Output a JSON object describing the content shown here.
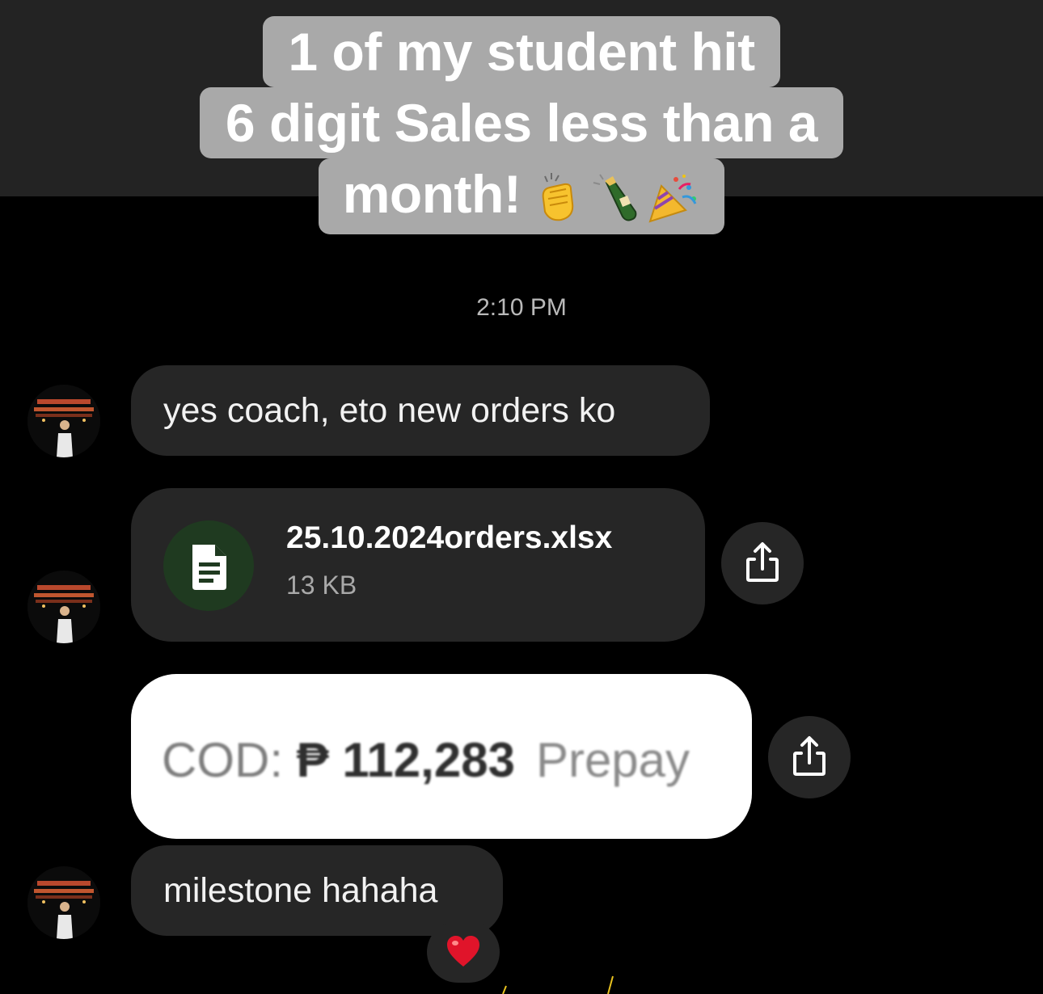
{
  "caption": {
    "line1": "1 of my student hit",
    "line2": "6 digit Sales less than a",
    "line3": "month!",
    "emojis": [
      "clapping-hands-icon",
      "champagne-bottle-icon",
      "party-popper-icon"
    ]
  },
  "chat": {
    "timestamp": "2:10 PM",
    "messages": [
      {
        "type": "text",
        "text": "yes coach, eto new orders ko"
      },
      {
        "type": "file",
        "filename": "25.10.2024orders.xlsx",
        "filesize": "13 KB"
      },
      {
        "type": "image",
        "cod_label": "COD:",
        "amount": "₱ 112,283",
        "trailing": "Prepay"
      },
      {
        "type": "text",
        "text": "milestone hahaha",
        "reaction": "heart-icon"
      }
    ]
  },
  "colors": {
    "background": "#000000",
    "top_band": "#232323",
    "caption_bg": "#a9a9a9",
    "bubble": "#262626",
    "file_icon_bg": "#1f3a20",
    "heart": "#e0142a"
  }
}
